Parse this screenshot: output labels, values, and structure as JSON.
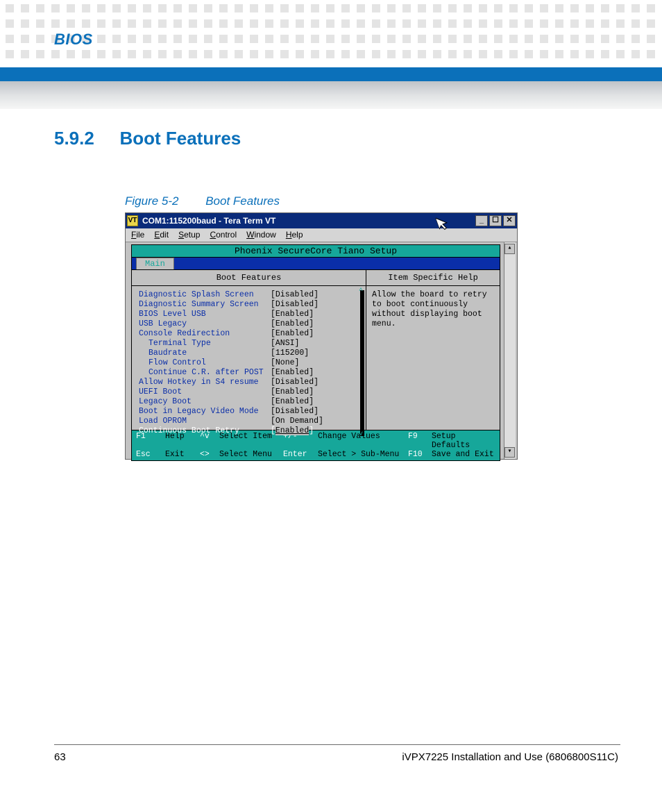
{
  "header": {
    "chapter": "BIOS"
  },
  "section": {
    "number": "5.9.2",
    "title": "Boot Features"
  },
  "figure": {
    "label": "Figure 5-2",
    "title": "Boot Features"
  },
  "window": {
    "title": "COM1:115200baud - Tera Term VT",
    "menus": {
      "file": "File",
      "edit": "Edit",
      "setup": "Setup",
      "control": "Control",
      "window": "Window",
      "help": "Help"
    },
    "buttons": {
      "min": "_",
      "max": "☐",
      "close": "✕"
    }
  },
  "bios": {
    "product": "Phoenix SecureCore Tiano Setup",
    "tab": "Main",
    "left_header": "Boot Features",
    "right_header": "Item Specific Help",
    "help_text": "Allow the board to retry to boot continuously without displaying boot menu.",
    "settings": [
      {
        "name": "Diagnostic Splash Screen",
        "value": "[Disabled]",
        "indent": false
      },
      {
        "name": "Diagnostic Summary Screen",
        "value": "[Disabled]",
        "indent": false
      },
      {
        "name": "BIOS Level USB",
        "value": "[Enabled]",
        "indent": false
      },
      {
        "name": "USB Legacy",
        "value": "[Enabled]",
        "indent": false
      },
      {
        "name": "Console Redirection",
        "value": "[Enabled]",
        "indent": false
      },
      {
        "name": "Terminal Type",
        "value": "[ANSI]",
        "indent": true
      },
      {
        "name": "Baudrate",
        "value": "[115200]",
        "indent": true
      },
      {
        "name": "Flow Control",
        "value": "[None]",
        "indent": true
      },
      {
        "name": "Continue C.R. after POST",
        "value": "[Enabled]",
        "indent": true
      },
      {
        "name": "Allow Hotkey in S4 resume",
        "value": "[Disabled]",
        "indent": false
      },
      {
        "name": "UEFI Boot",
        "value": "[Enabled]",
        "indent": false
      },
      {
        "name": "Legacy Boot",
        "value": "[Enabled]",
        "indent": false
      },
      {
        "name": "Boot in Legacy Video Mode",
        "value": "[Disabled]",
        "indent": false
      },
      {
        "name": "Load OPROM",
        "value": "[On Demand]",
        "indent": false
      }
    ],
    "selected": {
      "name": "Continuous Boot Retry",
      "value": "Enabled"
    },
    "hotkeys": {
      "r1": {
        "k1": "F1",
        "a1": "Help",
        "k2": "^v",
        "a2": "Select Item",
        "k3": "+/-",
        "a3": "Change Values",
        "k4": "F9",
        "a4": "Setup Defaults"
      },
      "r2": {
        "k1": "Esc",
        "a1": "Exit",
        "k2": "<>",
        "a2": "Select Menu",
        "k3": "Enter",
        "a3": "Select > Sub-Menu",
        "k4": "F10",
        "a4": "Save and Exit"
      }
    }
  },
  "footer": {
    "page": "63",
    "doc": "iVPX7225 Installation and Use (6806800S11C)"
  }
}
